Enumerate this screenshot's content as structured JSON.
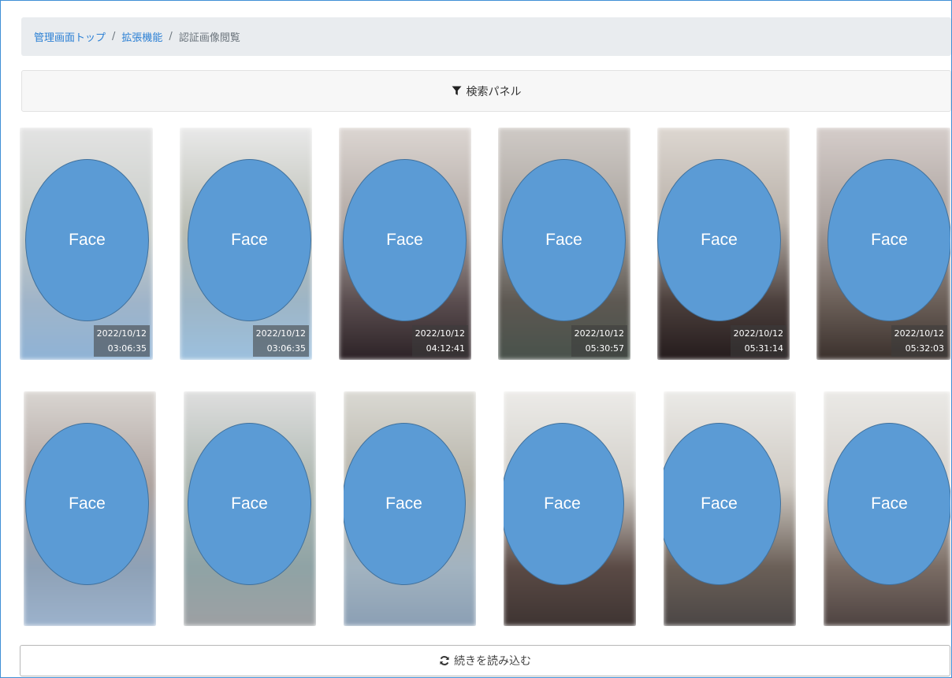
{
  "breadcrumb": {
    "items": [
      "管理画面トップ",
      "拡張機能"
    ],
    "current": "認証画像閲覧",
    "separator": "/"
  },
  "search_panel": {
    "label": "検索パネル",
    "icon": "filter-icon"
  },
  "thumbnails": [
    {
      "face": "Face",
      "date": "2022/10/12",
      "time": "03:06:35"
    },
    {
      "face": "Face",
      "date": "2022/10/12",
      "time": "03:06:35"
    },
    {
      "face": "Face",
      "date": "2022/10/12",
      "time": "04:12:41"
    },
    {
      "face": "Face",
      "date": "2022/10/12",
      "time": "05:30:57"
    },
    {
      "face": "Face",
      "date": "2022/10/12",
      "time": "05:31:14"
    },
    {
      "face": "Face",
      "date": "2022/10/12",
      "time": "05:32:03"
    },
    {
      "face": "Face"
    },
    {
      "face": "Face"
    },
    {
      "face": "Face"
    },
    {
      "face": "Face"
    },
    {
      "face": "Face"
    },
    {
      "face": "Face"
    }
  ],
  "load_more": {
    "label": "続きを読み込む",
    "icon": "refresh-icon"
  },
  "colors": {
    "link": "#2a7fd4",
    "face_fill": "#5b9bd5",
    "face_stroke": "#41719c"
  }
}
